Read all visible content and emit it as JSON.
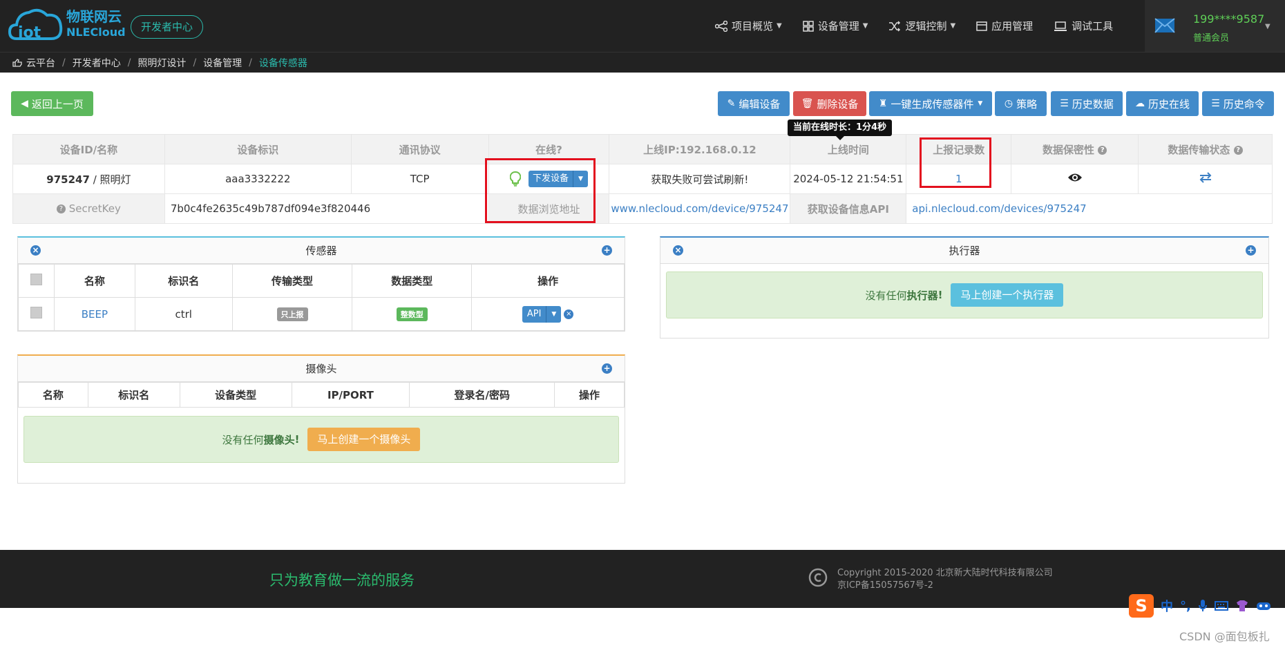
{
  "header": {
    "logo_cn": "物联网云",
    "logo_en": "NLECloud",
    "dev_center": "开发者中心",
    "nav": [
      {
        "label": "项目概览",
        "icon": "share-icon",
        "dropdown": true
      },
      {
        "label": "设备管理",
        "icon": "grid-icon",
        "dropdown": true
      },
      {
        "label": "逻辑控制",
        "icon": "shuffle-icon",
        "dropdown": true
      },
      {
        "label": "应用管理",
        "icon": "app-icon",
        "dropdown": false
      },
      {
        "label": "调试工具",
        "icon": "laptop-icon",
        "dropdown": false
      }
    ],
    "user_name": "199****9587",
    "user_level": "普通会员"
  },
  "breadcrumb": [
    "云平台",
    "开发者中心",
    "照明灯设计",
    "设备管理",
    "设备传感器"
  ],
  "toolbar": {
    "back": "返回上一页",
    "edit": "编辑设备",
    "delete": "删除设备",
    "generate": "一键生成传感器件",
    "strategy": "策略",
    "history_data": "历史数据",
    "history_online": "历史在线",
    "history_cmd": "历史命令"
  },
  "tooltip": "当前在线时长：1分4秒",
  "device": {
    "headers": [
      "设备ID/名称",
      "设备标识",
      "通讯协议",
      "在线?",
      "上线IP:192.168.0.12",
      "上线时间",
      "上报记录数",
      "数据保密性",
      "数据传输状态"
    ],
    "id": "975247",
    "name": " / 照明灯",
    "tag": "aaa3332222",
    "protocol": "TCP",
    "send_btn": "下发设备",
    "ip_status": "获取失败可尝试刷新!",
    "online_time": "2024-05-12 21:54:51",
    "report_count": "1",
    "secret_label": "SecretKey",
    "secret_value": "7b0c4fe2635c49b787df094e3f820446",
    "browse_label": "数据浏览地址",
    "browse_url": "www.nlecloud.com/device/975247",
    "api_label": "获取设备信息API",
    "api_url": "api.nlecloud.com/devices/975247"
  },
  "sensor_panel": {
    "title": "传感器",
    "headers": [
      "名称",
      "标识名",
      "传输类型",
      "数据类型",
      "操作"
    ],
    "rows": [
      {
        "name": "BEEP",
        "ident": "ctrl",
        "trans": "只上报",
        "dtype": "整数型",
        "action": "API"
      }
    ]
  },
  "actuator_panel": {
    "title": "执行器",
    "empty_prefix": "没有任何",
    "empty_strong": "执行器",
    "empty_suffix": "!",
    "create": "马上创建一个执行器"
  },
  "camera_panel": {
    "title": "摄像头",
    "headers": [
      "名称",
      "标识名",
      "设备类型",
      "IP/PORT",
      "登录名/密码",
      "操作"
    ],
    "empty_prefix": "没有任何",
    "empty_strong": "摄像头",
    "empty_suffix": "!",
    "create": "马上创建一个摄像头"
  },
  "footer": {
    "slogan": "只为教育做一流的服务",
    "copyright": "Copyright 2015-2020 北京新大陆时代科技有限公司",
    "icp": "京ICP备15057567号-2"
  },
  "ime": {
    "label": "中"
  },
  "watermark": "CSDN @面包板扎",
  "colors": {
    "accent": "#2bbbad",
    "primary": "#428bca",
    "danger": "#d9534f",
    "success": "#5cb85c",
    "warning": "#f0ad4e",
    "highlight": "#e3101e"
  }
}
